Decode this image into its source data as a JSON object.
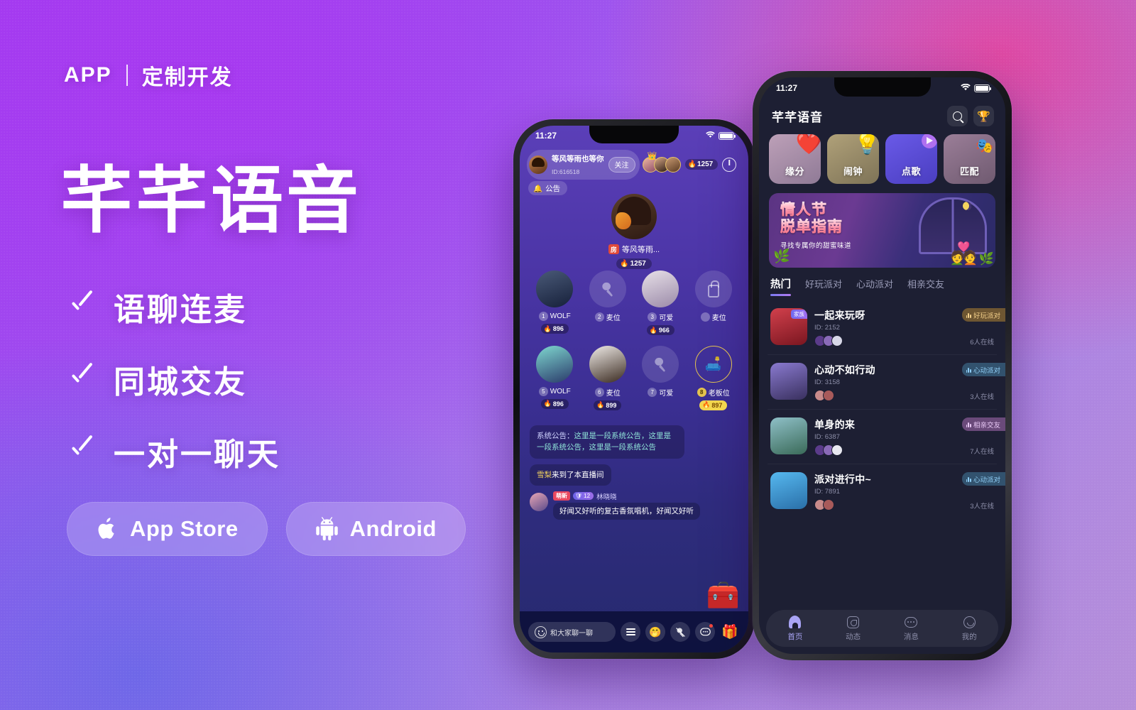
{
  "theme": {
    "bg_start": "#a03cf0",
    "bg_mid": "#e246a0",
    "bg_end": "#b58fd9",
    "accent": "#ffffff"
  },
  "left_panel": {
    "kicker_left": "APP",
    "kicker_right": "定制开发",
    "brand": "芊芊语音",
    "features": [
      {
        "label": "语聊连麦",
        "icon": "check-icon"
      },
      {
        "label": "同城交友",
        "icon": "check-icon"
      },
      {
        "label": "一对一聊天",
        "icon": "check-icon"
      }
    ],
    "stores": [
      {
        "label": "App Store",
        "icon": "apple-icon"
      },
      {
        "label": "Android",
        "icon": "android-icon"
      }
    ]
  },
  "phone1": {
    "status": {
      "time": "11:27",
      "wifi": "wifi-icon",
      "battery": "battery-icon"
    },
    "header": {
      "room_name": "等风等雨也等你",
      "room_id": "ID:616518",
      "follow_label": "关注",
      "hot_value": "1257",
      "hot_icon": "fire-icon",
      "power_icon": "power-icon",
      "crown_icon": "crown-icon"
    },
    "notice": {
      "label": "公告",
      "icon": "bell-icon"
    },
    "host": {
      "tag": "房",
      "name": "等风等雨...",
      "hot_value": "1257",
      "hot_icon": "fire-icon"
    },
    "seats": [
      {
        "num": "1",
        "label": "WOLF",
        "hot": "896",
        "state": "occupied"
      },
      {
        "num": "2",
        "label": "麦位",
        "hot": "",
        "state": "empty"
      },
      {
        "num": "3",
        "label": "可爱",
        "hot": "966",
        "state": "occupied"
      },
      {
        "num": "",
        "label": "麦位",
        "hot": "",
        "state": "locked"
      },
      {
        "num": "5",
        "label": "WOLF",
        "hot": "896",
        "state": "occupied"
      },
      {
        "num": "6",
        "label": "麦位",
        "hot": "899",
        "state": "occupied"
      },
      {
        "num": "7",
        "label": "可爱",
        "hot": "",
        "state": "empty"
      },
      {
        "num": "8",
        "label": "老板位",
        "hot": "897",
        "state": "boss"
      }
    ],
    "chat": {
      "system_key": "系统公告：",
      "system_value": "这里是一段系统公告，这里是一段系统公告，这里是一段系统公告",
      "enter_name": "雪梨",
      "enter_text": "来到了本直播间",
      "msg_tag": "萌新",
      "msg_level": "12",
      "msg_nick": "林晓晓",
      "msg_text": "好闻又好听的复古香氛唱机，好闻又好听",
      "treasure_icon": "treasure-chest-icon"
    },
    "toolbar": {
      "say_placeholder": "和大家聊一聊",
      "smile_icon": "smile-icon",
      "buttons": [
        {
          "icon": "menu-icon",
          "label": ""
        },
        {
          "icon": "emoji-icon",
          "label": "🤭"
        },
        {
          "icon": "mic-off-icon",
          "label": ""
        },
        {
          "icon": "message-icon",
          "label": ""
        },
        {
          "icon": "gift-icon",
          "label": "🎁"
        }
      ]
    }
  },
  "phone2": {
    "status": {
      "time": "11:27",
      "wifi": "wifi-icon",
      "battery": "battery-icon"
    },
    "app_title": "芊芊语音",
    "top_icons": [
      {
        "name": "search-icon",
        "glyph": ""
      },
      {
        "name": "trophy-icon",
        "glyph": "🏆"
      }
    ],
    "nav_cards": [
      {
        "label": "缘分",
        "icon": "heart-icon",
        "glyph": "❤️",
        "color": "#b08da8"
      },
      {
        "label": "闹钟",
        "icon": "lightbulb-icon",
        "glyph": "💡",
        "color": "#9e8d68"
      },
      {
        "label": "点歌",
        "icon": "play-icon",
        "glyph": "",
        "color": "#5b4fd8"
      },
      {
        "label": "匹配",
        "icon": "match-icon",
        "glyph": "🎭",
        "color": "#8a6f88"
      }
    ],
    "banner": {
      "line1": "情人节",
      "line2": "脱单指南",
      "subtitle": "寻找专属你的甜蜜味道",
      "art": "valentine-illustration"
    },
    "tabs": [
      {
        "label": "热门",
        "active": true
      },
      {
        "label": "好玩派对",
        "active": false
      },
      {
        "label": "心动派对",
        "active": false
      },
      {
        "label": "相亲交友",
        "active": false
      }
    ],
    "rooms": [
      {
        "name": "一起来玩呀",
        "id": "ID: 2152",
        "badge": "好玩派对",
        "badge_color": "#8a6a3a",
        "badge_text_color": "#f3cf8a",
        "online": "6人在线",
        "family_tag": "家族",
        "thumb_color": "#c0323c",
        "faces": 3
      },
      {
        "name": "心动不如行动",
        "id": "ID: 3158",
        "badge": "心动派对",
        "badge_color": "#3b5f84",
        "badge_text_color": "#8ecdf5",
        "online": "3人在线",
        "family_tag": "",
        "thumb_color": "#6a5a9a",
        "faces": 2
      },
      {
        "name": "单身的来",
        "id": "ID: 6387",
        "badge": "相亲交友",
        "badge_color": "#7a5a88",
        "badge_text_color": "#e3c3f0",
        "online": "7人在线",
        "family_tag": "",
        "thumb_color": "#6e9ba8",
        "faces": 3
      },
      {
        "name": "派对进行中~",
        "id": "ID: 7891",
        "badge": "心动派对",
        "badge_color": "#3b5f84",
        "badge_text_color": "#8ecdf5",
        "online": "3人在线",
        "family_tag": "",
        "thumb_color": "#3f9ad8",
        "faces": 2
      }
    ],
    "tabbar": [
      {
        "label": "首页",
        "icon": "home-icon",
        "active": true
      },
      {
        "label": "动态",
        "icon": "moments-icon",
        "active": false
      },
      {
        "label": "消息",
        "icon": "message-icon",
        "active": false
      },
      {
        "label": "我的",
        "icon": "profile-icon",
        "active": false
      }
    ]
  }
}
